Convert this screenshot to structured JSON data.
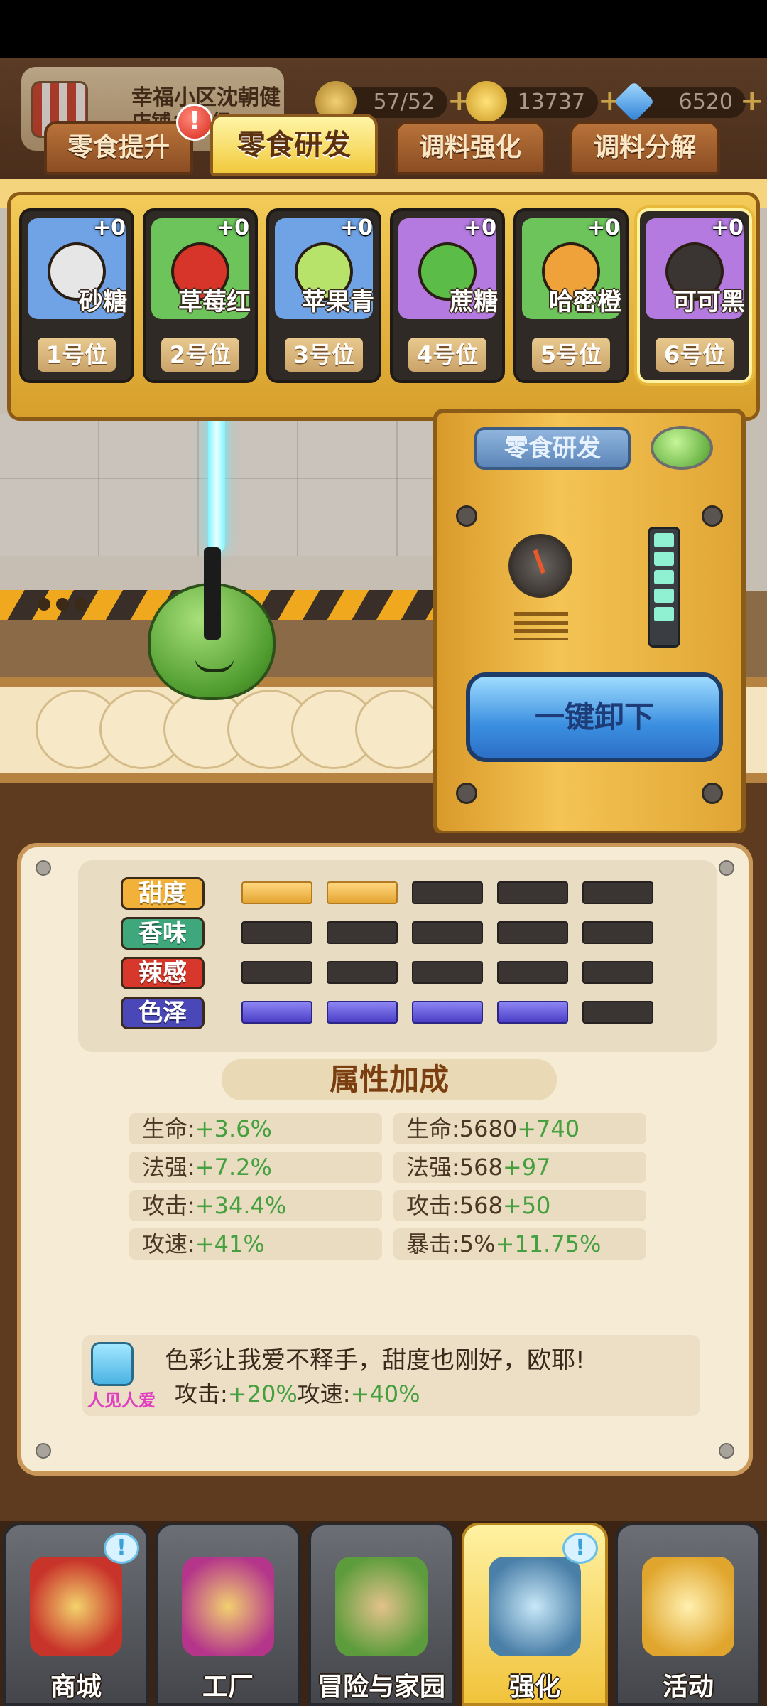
{
  "header": {
    "shop_name": "幸福小区沈朝健",
    "shop_sub": "店铺：1 级",
    "resources": [
      {
        "name": "energy",
        "value": "57/52",
        "icon": "lightning-icon",
        "color": "#e6b54a"
      },
      {
        "name": "coins",
        "value": "13737",
        "icon": "coin-icon",
        "color": "#f2c442"
      },
      {
        "name": "diamonds",
        "value": "6520",
        "icon": "diamond-icon",
        "color": "#4aa8f0"
      }
    ]
  },
  "tabs": [
    {
      "label": "零食提升",
      "active": false,
      "alert": "!"
    },
    {
      "label": "零食研发",
      "active": true
    },
    {
      "label": "调料强化",
      "active": false
    },
    {
      "label": "调料分解",
      "active": false
    }
  ],
  "slots": [
    {
      "name": "砂糖",
      "level": "+0",
      "position": "1号位",
      "bg": "#6fa3e6"
    },
    {
      "name": "草莓红",
      "level": "+0",
      "position": "2号位",
      "bg": "#6cc45a"
    },
    {
      "name": "苹果青",
      "level": "+0",
      "position": "3号位",
      "bg": "#6fa3e6"
    },
    {
      "name": "蔗糖",
      "level": "+0",
      "position": "4号位",
      "bg": "#b47ae0"
    },
    {
      "name": "哈密橙",
      "level": "+0",
      "position": "5号位",
      "bg": "#6cc45a"
    },
    {
      "name": "可可黑",
      "level": "+0",
      "position": "6号位",
      "bg": "#b47ae0"
    }
  ],
  "machine": {
    "sign": "零食研发",
    "unload_button": "一键卸下"
  },
  "attributes": [
    {
      "label": "甜度",
      "color": "#f2b23a",
      "level": 2,
      "of": 5
    },
    {
      "label": "香味",
      "color": "#3ea87c",
      "level": 0,
      "of": 5
    },
    {
      "label": "辣感",
      "color": "#d8382c",
      "level": 0,
      "of": 5
    },
    {
      "label": "色泽",
      "color": "#4a47b8",
      "level": 4,
      "of": 5
    }
  ],
  "bonus_title": "属性加成",
  "stats_left": [
    {
      "key": "生命:",
      "value": "+3.6%"
    },
    {
      "key": "法强:",
      "value": "+7.2%"
    },
    {
      "key": "攻击:",
      "value": "+34.4%"
    },
    {
      "key": "攻速:",
      "value": "+41%"
    }
  ],
  "stats_right": [
    {
      "key": "生命:5680",
      "value": "+740"
    },
    {
      "key": "法强:568",
      "value": "+97"
    },
    {
      "key": "攻击:568",
      "value": "+50"
    },
    {
      "key": "暴击:5%",
      "value": "+11.75%"
    }
  ],
  "combo": {
    "tag": "人见人爱",
    "text": "色彩让我爱不释手，甜度也刚好，欧耶!",
    "effect_key1": "攻击:",
    "effect_val1": "+20%",
    "effect_key2": "攻速:",
    "effect_val2": "+40%"
  },
  "nav": [
    {
      "label": "商城",
      "icon": "shop-basket-icon",
      "badge": "!",
      "active": false
    },
    {
      "label": "工厂",
      "icon": "factory-icon",
      "active": false
    },
    {
      "label": "冒险与家园",
      "icon": "adventure-icon",
      "active": false
    },
    {
      "label": "强化",
      "icon": "enhance-machine-icon",
      "badge": "!",
      "active": true
    },
    {
      "label": "活动",
      "icon": "horn-icon",
      "active": false
    }
  ]
}
